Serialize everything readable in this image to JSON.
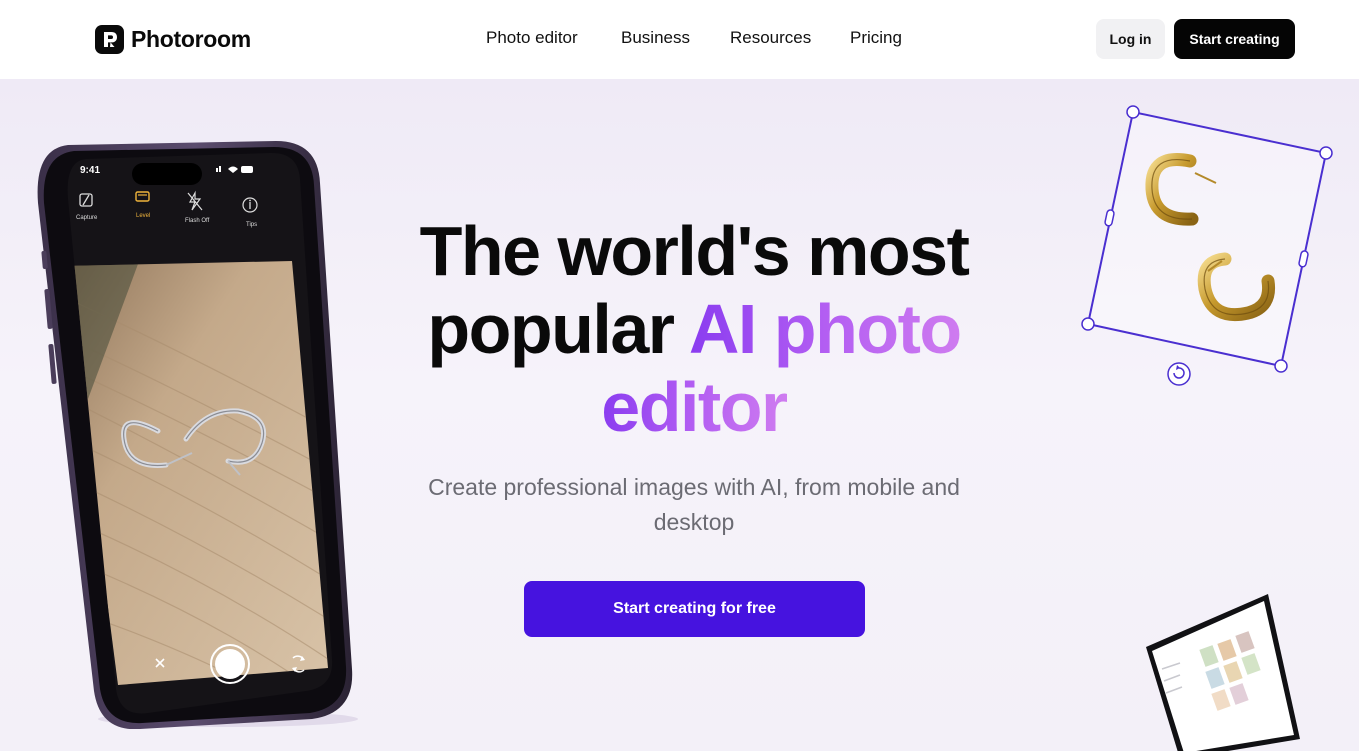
{
  "nav": {
    "brand": "Photoroom",
    "menu": [
      "Photo editor",
      "Business",
      "Resources",
      "Pricing"
    ],
    "login_label": "Log in",
    "start_label": "Start creating"
  },
  "hero": {
    "headline_line1": "The world's most",
    "headline_line2a": "popular ",
    "headline_line2b": "AI photo",
    "headline_line3": "editor",
    "subtitle": "Create professional images with AI, from mobile and desktop",
    "cta_label": "Start creating for free"
  },
  "phone": {
    "time": "9:41",
    "tools": [
      "Capture",
      "Level",
      "Flash Off",
      "Tips"
    ],
    "icons": [
      "capture-icon",
      "level-icon",
      "flash-off-icon",
      "tips-icon",
      "close-icon",
      "shutter-button",
      "flip-camera-icon"
    ]
  },
  "colors": {
    "accent": "#4613df",
    "headline_gradient_start": "#8a3cf0",
    "headline_gradient_end": "#cf7cf0",
    "selection_frame": "#4a2fd0",
    "nav_start_bg": "#050505",
    "hero_bg": "#f3f0f8"
  }
}
